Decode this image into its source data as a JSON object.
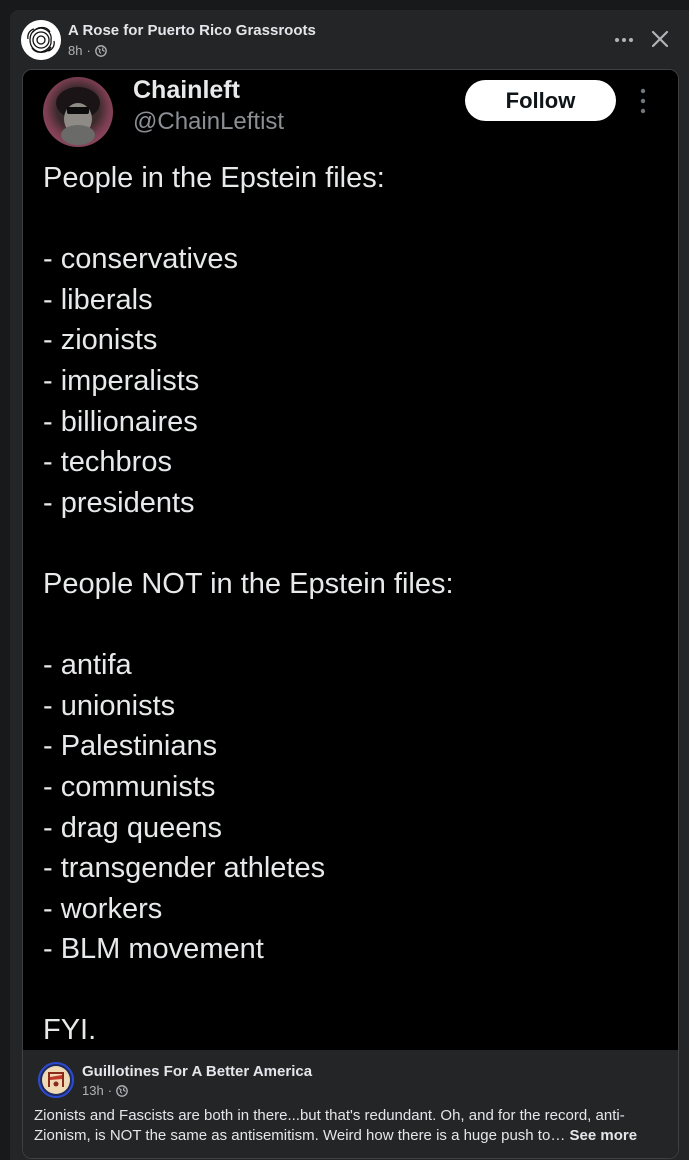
{
  "post": {
    "page_name": "A Rose for Puerto Rico Grassroots",
    "time": "8h",
    "separator": "·"
  },
  "tweet": {
    "name": "Chainleft",
    "handle": "@ChainLeftist",
    "follow_label": "Follow",
    "body": "People in the Epstein files:\n\n- conservatives\n- liberals\n- zionists\n- imperalists\n- billionaires\n- techbros\n- presidents\n\nPeople NOT in the Epstein files:\n\n- antifa\n- unionists\n- Palestinians\n- communists\n- drag queens\n- transgender athletes\n- workers\n- BLM movement\n\nFYI."
  },
  "shared": {
    "page_name": "Guillotines For A Better America",
    "time": "13h",
    "separator": "·",
    "text": "Zionists and Fascists are both in there...but that's redundant. Oh, and for the record, anti-Zionism, is NOT the same as antisemitism. Weird how there is a huge push to…",
    "see_more": "See more"
  },
  "icons": {
    "more": "more-horizontal-icon",
    "close": "close-icon",
    "globe": "globe-icon",
    "tweet_menu": "more-vertical-icon"
  },
  "colors": {
    "background": "#18191a",
    "card": "#242526",
    "tweet_background": "#000000",
    "secondary_text": "#b0b3b8"
  }
}
